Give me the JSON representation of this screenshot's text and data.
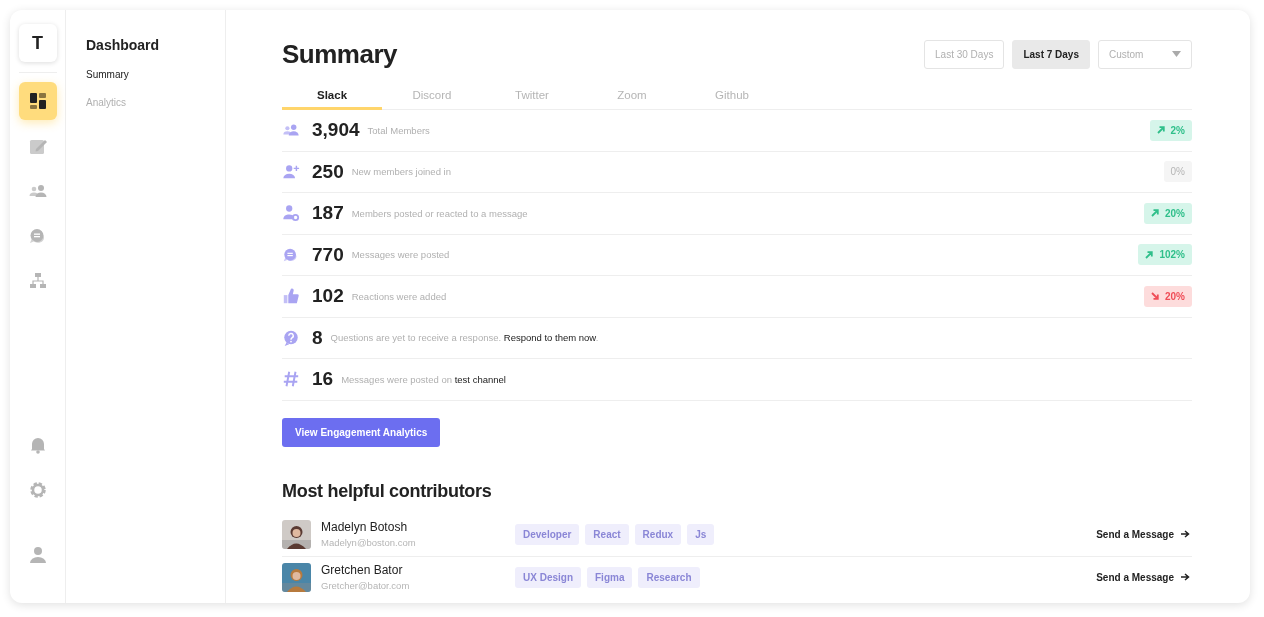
{
  "logo": "T",
  "rail": {
    "top": [
      {
        "kind": "dashboard",
        "selected": true
      },
      {
        "kind": "edit",
        "selected": false
      },
      {
        "kind": "people",
        "selected": false
      },
      {
        "kind": "chat",
        "selected": false
      },
      {
        "kind": "hierarchy",
        "selected": false
      }
    ],
    "bottom": [
      {
        "kind": "bell"
      },
      {
        "kind": "gear"
      },
      {
        "kind": "user"
      }
    ]
  },
  "sidebar": {
    "title": "Dashboard",
    "items": [
      {
        "label": "Summary",
        "selected": true
      },
      {
        "label": "Analytics",
        "selected": false
      }
    ]
  },
  "title": "Summary",
  "ranges": [
    {
      "label": "Last 30 Days",
      "selected": false
    },
    {
      "label": "Last 7 Days",
      "selected": true
    }
  ],
  "range_dropdown": {
    "value": "Custom"
  },
  "tabs": [
    {
      "label": "Slack",
      "selected": true
    },
    {
      "label": "Discord",
      "selected": false
    },
    {
      "label": "Twitter",
      "selected": false
    },
    {
      "label": "Zoom",
      "selected": false
    },
    {
      "label": "Github",
      "selected": false
    }
  ],
  "stats": [
    {
      "kind": "people",
      "value": "3,904",
      "label": "Total Members",
      "change": {
        "text": "2%",
        "kind": "up"
      }
    },
    {
      "kind": "personadd",
      "value": "250",
      "label": "New members joined in",
      "change": {
        "text": "0%",
        "kind": "flat"
      }
    },
    {
      "kind": "personactive",
      "value": "187",
      "label": "Members posted or reacted to a message",
      "change": {
        "text": "20%",
        "kind": "up"
      }
    },
    {
      "kind": "chat",
      "value": "770",
      "label": "Messages were posted",
      "change": {
        "text": "102%",
        "kind": "up"
      }
    },
    {
      "kind": "thumb",
      "value": "102",
      "label": "Reactions were added",
      "change": {
        "text": "20%",
        "kind": "down"
      }
    },
    {
      "kind": "question",
      "value": "8",
      "label": "Questions are yet to receive a response. **Respond to them now**."
    },
    {
      "kind": "hash",
      "value": "16",
      "label": "Messages were posted on **test channel**"
    }
  ],
  "cta": "View Engagement Analytics",
  "contributors_title": "Most helpful contributors",
  "contributors": [
    {
      "name": "Madelyn Botosh",
      "email": "Madelyn@boston.com",
      "tags": [
        "Developer",
        "React",
        "Redux",
        "Js"
      ],
      "action": "Send a Message"
    },
    {
      "name": "Gretchen Bator",
      "email": "Gretcher@bator.com",
      "tags": [
        "UX Design",
        "Figma",
        "Research"
      ],
      "action": "Send a Message"
    }
  ]
}
